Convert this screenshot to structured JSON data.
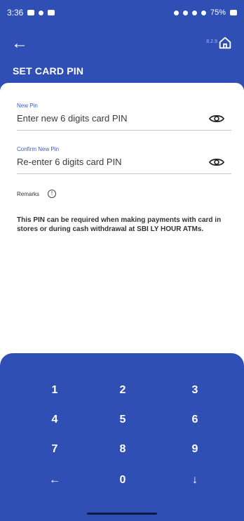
{
  "statusbar": {
    "time": "3:36",
    "battery": "75%"
  },
  "header": {
    "title": "SET CARD PIN",
    "version": "8.2.9"
  },
  "form": {
    "new_pin": {
      "label": "New Pin",
      "placeholder": "Enter new 6 digits card PIN"
    },
    "confirm_pin": {
      "label": "Confirm New Pin",
      "placeholder": "Re-enter 6 digits card PIN"
    }
  },
  "remarks": {
    "label": "Remarks",
    "icon": "info-icon",
    "text": "This PIN can be required when making payments with card in stores or during cash withdrawal at SBI LY HOUR ATMs."
  },
  "keypad": {
    "keys": [
      "1",
      "2",
      "3",
      "4",
      "5",
      "6",
      "7",
      "8",
      "9",
      "←",
      "0",
      "↓"
    ]
  },
  "colors": {
    "primary": "#2f4fb5",
    "label_accent": "#3a5bd1"
  }
}
